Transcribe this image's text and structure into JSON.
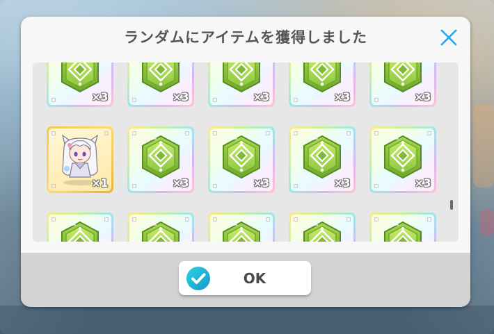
{
  "dialog": {
    "title": "ランダムにアイテムを獲得しました",
    "ok_label": "OK"
  },
  "icons": {
    "close": "close-x-icon",
    "ok": "checkmark-circle-icon",
    "item": "green-hexagon-gem-icon",
    "character": "character-portrait-icon"
  },
  "colors": {
    "close_icon": "#2ea8e8",
    "ok_icon": "#17b3d6",
    "gem_green": "#8cc63f",
    "rainbow_frame": "#c8f29c",
    "gold_frame": "#f4c84a"
  },
  "items": [
    {
      "type": "gem",
      "quantity": "×3",
      "frame": "rainbow"
    },
    {
      "type": "gem",
      "quantity": "×3",
      "frame": "rainbow"
    },
    {
      "type": "gem",
      "quantity": "×3",
      "frame": "rainbow"
    },
    {
      "type": "gem",
      "quantity": "×3",
      "frame": "rainbow"
    },
    {
      "type": "gem",
      "quantity": "×3",
      "frame": "rainbow"
    },
    {
      "type": "character",
      "quantity": "×1",
      "frame": "gold"
    },
    {
      "type": "gem",
      "quantity": "×3",
      "frame": "rainbow"
    },
    {
      "type": "gem",
      "quantity": "×3",
      "frame": "rainbow"
    },
    {
      "type": "gem",
      "quantity": "×3",
      "frame": "rainbow"
    },
    {
      "type": "gem",
      "quantity": "×3",
      "frame": "rainbow"
    },
    {
      "type": "gem",
      "quantity": "",
      "frame": "rainbow"
    },
    {
      "type": "gem",
      "quantity": "",
      "frame": "rainbow"
    },
    {
      "type": "gem",
      "quantity": "",
      "frame": "rainbow"
    },
    {
      "type": "gem",
      "quantity": "",
      "frame": "rainbow"
    },
    {
      "type": "gem",
      "quantity": "",
      "frame": "rainbow"
    }
  ]
}
